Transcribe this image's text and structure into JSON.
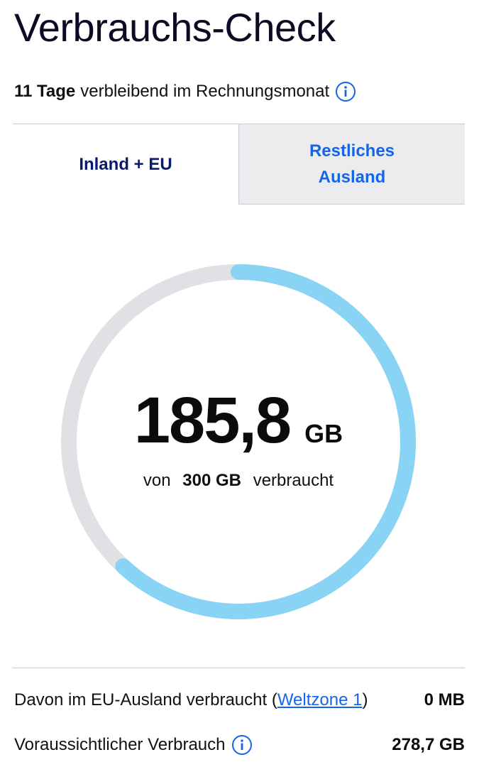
{
  "header": {
    "title": "Verbrauchs-Check"
  },
  "billing": {
    "days_bold": "11 Tage",
    "days_rest": "verbleibend im Rechnungsmonat"
  },
  "tabs": [
    {
      "label": "Inland + EU",
      "active": true
    },
    {
      "label": "Restliches Ausland",
      "active": false
    }
  ],
  "usage": {
    "value": "185,8",
    "unit": "GB",
    "prefix": "von",
    "total": "300 GB",
    "suffix": "verbraucht",
    "fraction_used": 0.619
  },
  "details": {
    "eu_label_start": "Davon im EU-Ausland verbraucht (",
    "eu_link": "Weltzone 1",
    "eu_label_end": ")",
    "eu_value": "0 MB",
    "forecast_label": "Voraussichtlicher Verbrauch",
    "forecast_value": "278,7 GB"
  },
  "colors": {
    "accent": "#1565e6",
    "gauge_fill": "#89d4f5",
    "gauge_track": "#e1e1e5",
    "tab_active_text": "#0a1b6b"
  },
  "icons": {
    "info": "info-circle-icon"
  }
}
